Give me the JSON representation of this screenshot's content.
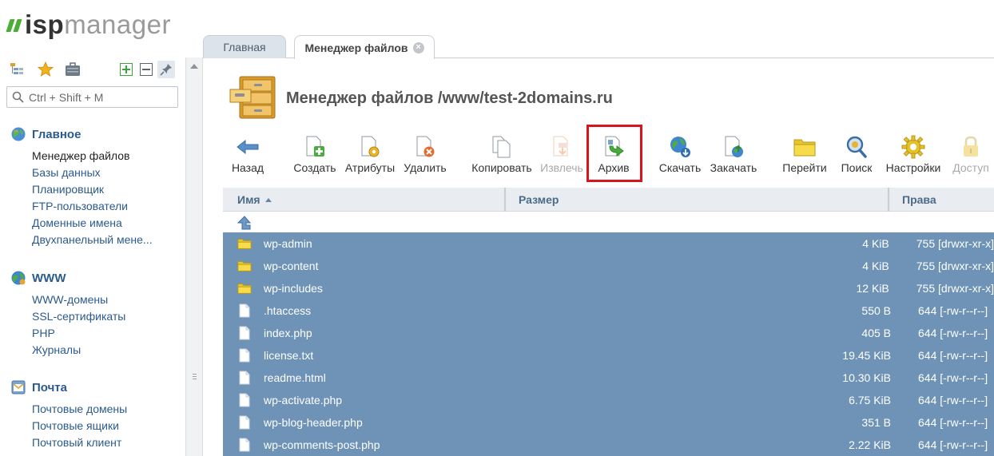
{
  "logo": {
    "part1": "isp",
    "part2": "manager"
  },
  "search": {
    "placeholder": "Ctrl + Shift + M"
  },
  "nav": [
    {
      "title": "Главное",
      "icon": "globe-icon",
      "items": [
        "Менеджер файлов",
        "Базы данных",
        "Планировщик",
        "FTP-пользователи",
        "Доменные имена",
        "Двухпанельный мене..."
      ]
    },
    {
      "title": "WWW",
      "icon": "www-icon",
      "items": [
        "WWW-домены",
        "SSL-сертификаты",
        "PHP",
        "Журналы"
      ]
    },
    {
      "title": "Почта",
      "icon": "mail-icon",
      "items": [
        "Почтовые домены",
        "Почтовые ящики",
        "Почтовый клиент"
      ]
    }
  ],
  "tabs": {
    "home": "Главная",
    "file_manager": "Менеджер файлов"
  },
  "page_title": "Менеджер файлов /www/test-2domains.ru",
  "toolbar": {
    "back": "Назад",
    "create": "Создать",
    "attributes": "Атрибуты",
    "delete": "Удалить",
    "copy": "Копировать",
    "extract": "Извлечь",
    "archive": "Архив",
    "download": "Скачать",
    "upload": "Закачать",
    "goto": "Перейти",
    "search": "Поиск",
    "settings": "Настройки",
    "access": "Доступ"
  },
  "table": {
    "headers": {
      "name": "Имя",
      "size": "Размер",
      "perms": "Права"
    },
    "rows": [
      {
        "type": "folder",
        "name": "wp-admin",
        "size": "4 KiB",
        "perms": "755 [drwxr-xr-x]"
      },
      {
        "type": "folder",
        "name": "wp-content",
        "size": "4 KiB",
        "perms": "755 [drwxr-xr-x]"
      },
      {
        "type": "folder",
        "name": "wp-includes",
        "size": "12 KiB",
        "perms": "755 [drwxr-xr-x]"
      },
      {
        "type": "file",
        "name": ".htaccess",
        "size": "550 B",
        "perms": "644 [-rw-r--r--]"
      },
      {
        "type": "file",
        "name": "index.php",
        "size": "405 B",
        "perms": "644 [-rw-r--r--]"
      },
      {
        "type": "file",
        "name": "license.txt",
        "size": "19.45 KiB",
        "perms": "644 [-rw-r--r--]"
      },
      {
        "type": "file",
        "name": "readme.html",
        "size": "10.30 KiB",
        "perms": "644 [-rw-r--r--]"
      },
      {
        "type": "file",
        "name": "wp-activate.php",
        "size": "6.75 KiB",
        "perms": "644 [-rw-r--r--]"
      },
      {
        "type": "file",
        "name": "wp-blog-header.php",
        "size": "351 B",
        "perms": "644 [-rw-r--r--]"
      },
      {
        "type": "file",
        "name": "wp-comments-post.php",
        "size": "2.22 KiB",
        "perms": "644 [-rw-r--r--]"
      }
    ]
  },
  "colors": {
    "selected_row": "#6e93b7",
    "highlight": "#d8141c",
    "nav_link": "#2b5a8c",
    "logo_green": "#4cae34"
  }
}
